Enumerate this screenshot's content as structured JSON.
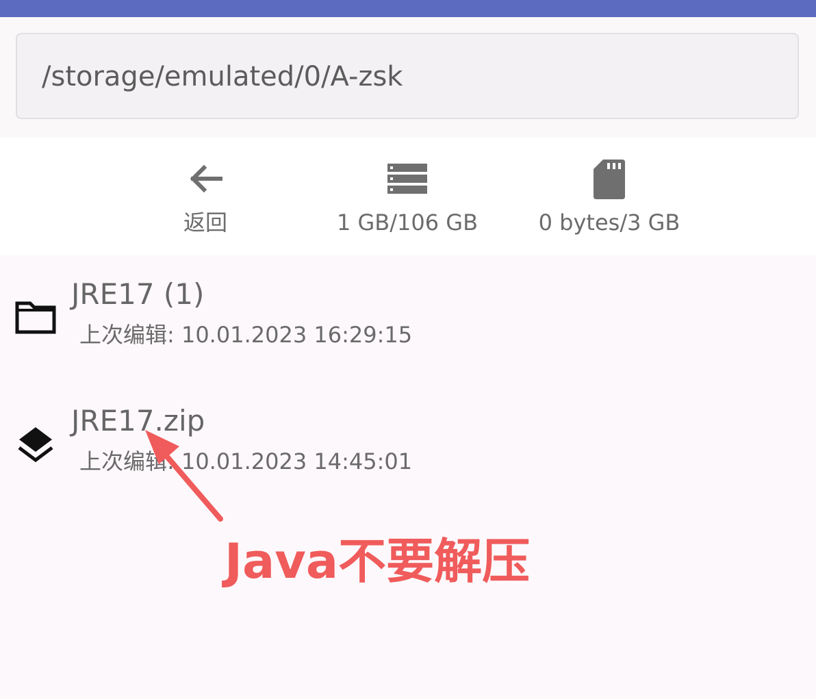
{
  "colors": {
    "topbar": "#5c6bc0",
    "annotation": "#f05b5b",
    "icon_gray": "#6f6f6f",
    "icon_black": "#111111"
  },
  "path_bar": {
    "value": "/storage/emulated/0/A-zsk"
  },
  "toolbar": {
    "back": {
      "icon": "arrow-left-icon",
      "label": "返回"
    },
    "internal_storage": {
      "icon": "storage-icon",
      "label": "1 GB/106 GB"
    },
    "sd_card": {
      "icon": "sd-card-icon",
      "label": "0 bytes/3 GB"
    }
  },
  "files": [
    {
      "icon": "folder-icon",
      "name": "JRE17 (1)",
      "meta": "上次编辑: 10.01.2023 16:29:15"
    },
    {
      "icon": "archive-layers-icon",
      "name": "JRE17.zip",
      "meta": "上次编辑: 10.01.2023 14:45:01"
    }
  ],
  "annotation": {
    "text": "Java不要解压"
  }
}
